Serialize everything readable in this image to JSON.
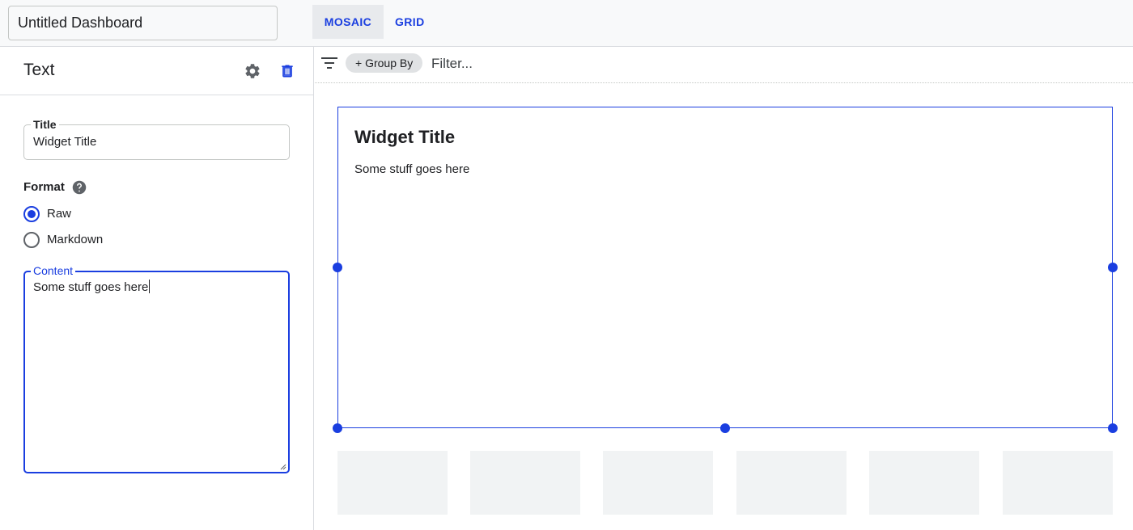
{
  "topbar": {
    "dashboard_name": "Untitled Dashboard",
    "tabs": [
      {
        "label": "MOSAIC",
        "active": true
      },
      {
        "label": "GRID",
        "active": false
      }
    ]
  },
  "sidebar": {
    "title": "Text",
    "actions": [
      "settings-icon",
      "delete-icon"
    ],
    "title_field": {
      "label": "Title",
      "value": "Widget Title"
    },
    "format": {
      "label": "Format",
      "options": [
        {
          "label": "Raw",
          "selected": true
        },
        {
          "label": "Markdown",
          "selected": false
        }
      ]
    },
    "content_field": {
      "label": "Content",
      "value": "Some stuff goes here"
    }
  },
  "filterbar": {
    "group_by_label": "+ Group By",
    "filter_placeholder": "Filter..."
  },
  "widget": {
    "title": "Widget Title",
    "body": "Some stuff goes here"
  },
  "colors": {
    "accent": "#1a3ee0",
    "border": "#dadce0",
    "placeholder_fill": "#f1f3f4"
  }
}
